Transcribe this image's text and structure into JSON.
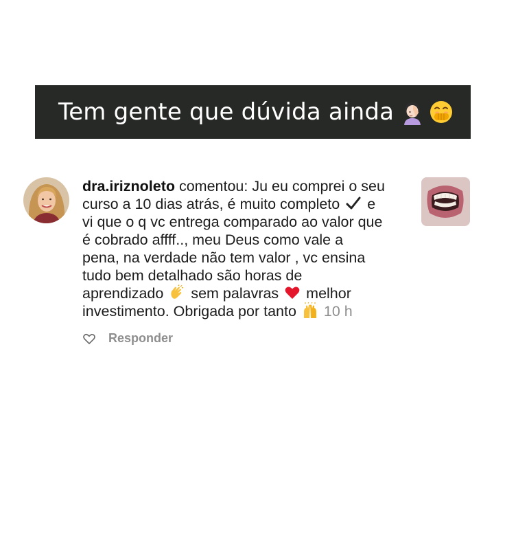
{
  "banner": {
    "text": "Tem gente que dúvida ainda",
    "emojis": [
      "face-palm-icon",
      "hand-over-mouth-icon"
    ]
  },
  "comment": {
    "username": "dra.iriznoleto",
    "verb": "comentou:",
    "lines": [
      "Ju eu comprei o seu",
      "curso a 10 dias atrás, é muito completo",
      "e",
      "vi que o q vc entrega comparado ao valor que",
      "é cobrado affff.., meu Deus como vale a",
      "pena, na verdade não tem valor , vc ensina",
      "tudo bem detalhado são horas de",
      "aprendizado",
      "sem palavras",
      "melhor",
      "investimento. Obrigada por tanto"
    ],
    "time": "10 h"
  },
  "actions": {
    "reply_label": "Responder"
  },
  "colors": {
    "banner_bg": "#262925",
    "banner_text": "#ffffff",
    "text": "#1c1c1c",
    "muted": "#8e8e8e",
    "heart": "#e3162c"
  }
}
